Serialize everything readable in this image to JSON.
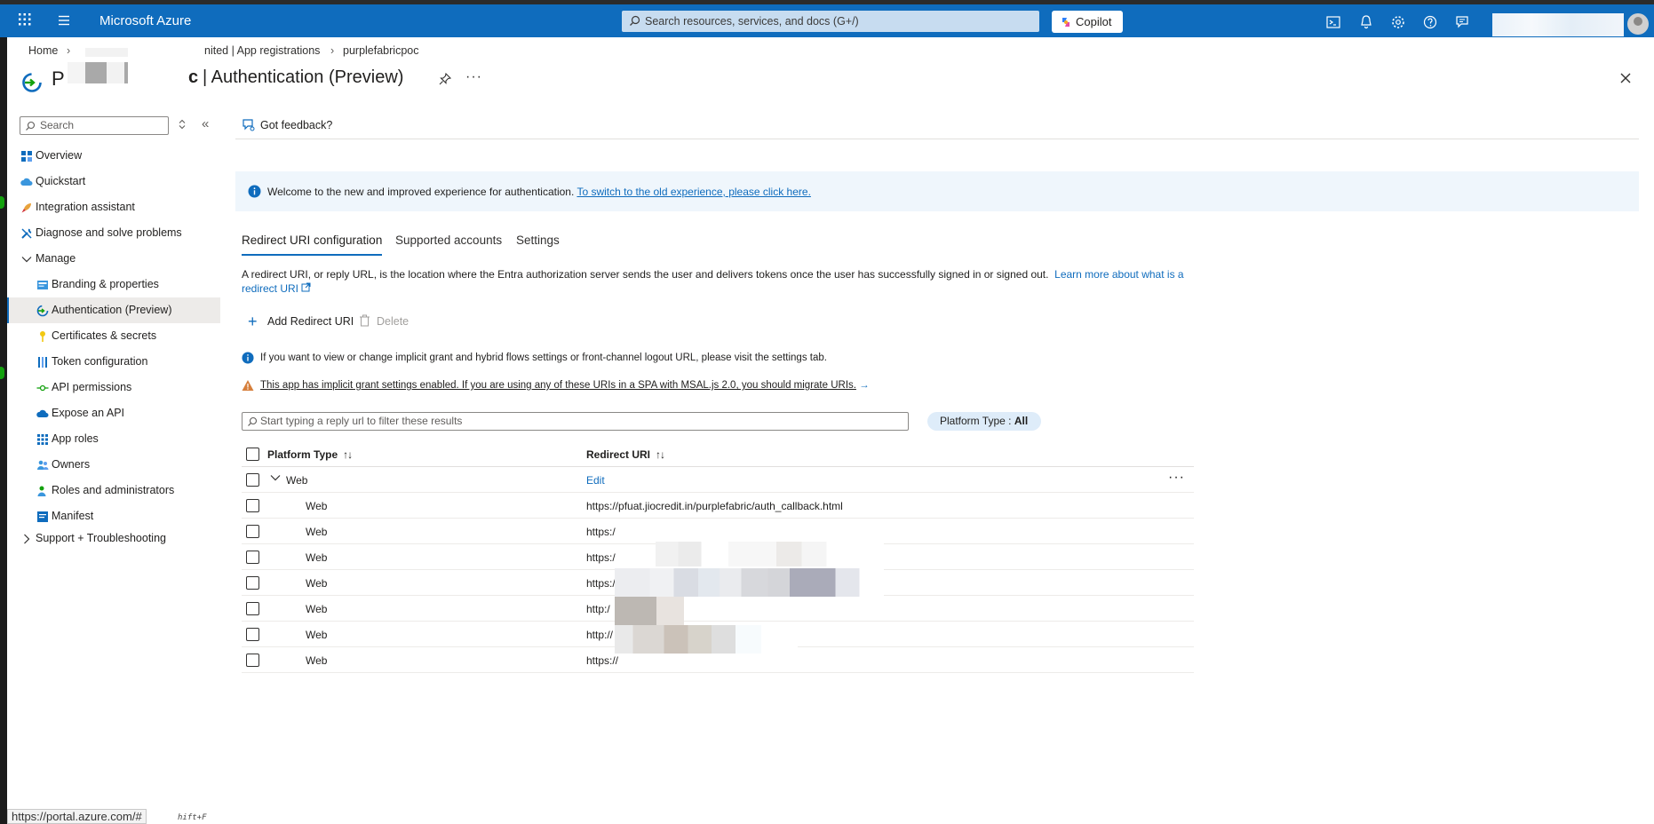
{
  "topbar": {
    "brand": "Microsoft Azure",
    "search_placeholder": "Search resources, services, and docs (G+/)",
    "copilot_label": "Copilot",
    "icons": [
      "cloud-shell-icon",
      "bell-icon",
      "gear-icon",
      "help-icon",
      "feedback-icon"
    ]
  },
  "breadcrumb": {
    "home": "Home",
    "app_registrations": "nited | App registrations",
    "app": "purplefabricpoc"
  },
  "page": {
    "title_fragment_left": "P",
    "title_fragment_right": "c",
    "title": "| Authentication (Preview)",
    "more": "···"
  },
  "sidebar": {
    "search_placeholder": "Search",
    "collapse": "«",
    "items": [
      {
        "label": "Overview",
        "icon": "overview-icon",
        "indent": false
      },
      {
        "label": "Quickstart",
        "icon": "cloud-quickstart-icon",
        "indent": false
      },
      {
        "label": "Integration assistant",
        "icon": "rocket-icon",
        "indent": false
      },
      {
        "label": "Diagnose and solve problems",
        "icon": "wrench-icon",
        "indent": false
      },
      {
        "label": "Manage",
        "icon": "chevron-down-icon",
        "indent": false,
        "group": true
      },
      {
        "label": "Branding & properties",
        "icon": "branding-icon",
        "indent": true
      },
      {
        "label": "Authentication (Preview)",
        "icon": "authentication-icon",
        "indent": true,
        "active": true
      },
      {
        "label": "Certificates & secrets",
        "icon": "key-icon",
        "indent": true
      },
      {
        "label": "Token configuration",
        "icon": "token-bars-icon",
        "indent": true
      },
      {
        "label": "API permissions",
        "icon": "api-permissions-icon",
        "indent": true
      },
      {
        "label": "Expose an API",
        "icon": "cloud-api-icon",
        "indent": true
      },
      {
        "label": "App roles",
        "icon": "grid-icon",
        "indent": true
      },
      {
        "label": "Owners",
        "icon": "people-icon",
        "indent": true
      },
      {
        "label": "Roles and administrators",
        "icon": "person-icon",
        "indent": true
      },
      {
        "label": "Manifest",
        "icon": "manifest-icon",
        "indent": true
      },
      {
        "label": "Support + Troubleshooting",
        "icon": "chevron-right-icon",
        "indent": false,
        "group": true
      }
    ]
  },
  "feedback": "Got feedback?",
  "info_banner": {
    "text": "Welcome to the new and improved experience for authentication.",
    "link": "To switch to the old experience, please click here."
  },
  "tabs": [
    "Redirect URI configuration",
    "Supported accounts",
    "Settings"
  ],
  "description": {
    "text": "A redirect URI, or reply URL, is the location where the Entra authorization server sends the user and delivers tokens once the user has successfully signed in or signed out.",
    "link": "Learn more about what is a redirect URI"
  },
  "commands": {
    "add": "Add Redirect URI",
    "delete": "Delete"
  },
  "notices": {
    "info": "If you want to view or change implicit grant and hybrid flows settings or front-channel logout URL, please visit the settings tab.",
    "warning": "This app has implicit grant settings enabled. If you are using any of these URIs in a SPA with MSAL.js 2.0, you should migrate URIs."
  },
  "filter": {
    "placeholder": "Start typing a reply url to filter these results",
    "platform_label": "Platform Type : ",
    "platform_value": "All"
  },
  "grid": {
    "col_platform": "Platform Type",
    "col_uri": "Redirect URI",
    "group": {
      "label": "Web",
      "action": "Edit"
    },
    "rows": [
      {
        "type": "Web",
        "uri": "https://pfuat.jiocredit.in/purplefabric/auth_callback.html"
      },
      {
        "type": "Web",
        "uri": "https:/"
      },
      {
        "type": "Web",
        "uri": "https:/"
      },
      {
        "type": "Web",
        "uri": "https:/"
      },
      {
        "type": "Web",
        "uri": "http:/"
      },
      {
        "type": "Web",
        "uri": "http://"
      },
      {
        "type": "Web",
        "uri": "https://"
      }
    ]
  },
  "statusbar": {
    "url": "https://portal.azure.com/#",
    "suffix": "hift+F"
  }
}
